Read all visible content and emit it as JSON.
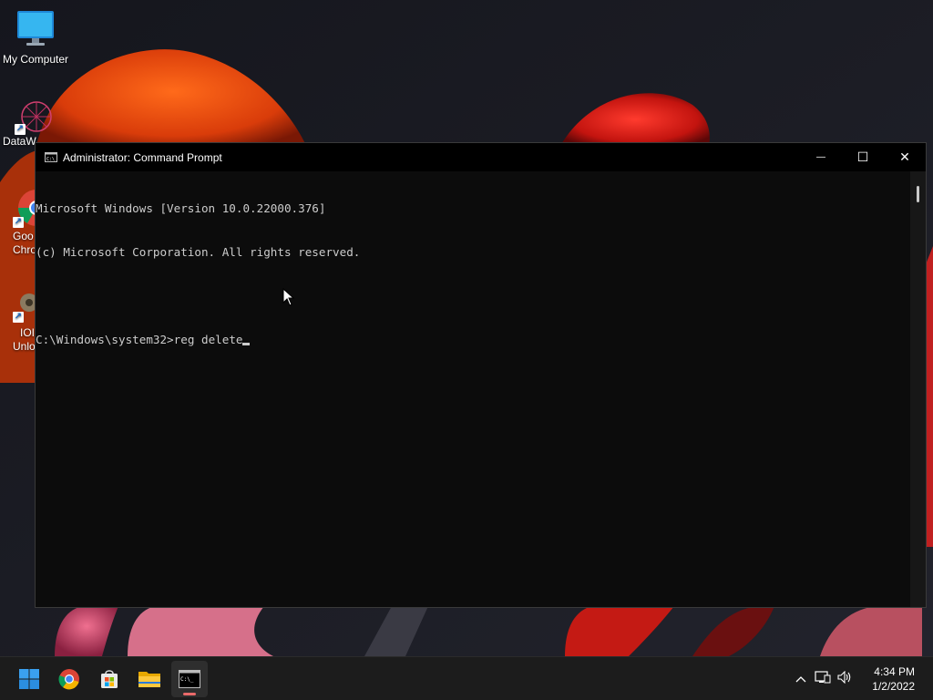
{
  "desktop": {
    "icons": [
      {
        "label": "My Computer"
      },
      {
        "label": "DataW"
      },
      {
        "label_line1": "Goo",
        "label_line2": "Chro"
      },
      {
        "label_line1": "IOI",
        "label_line2": "Unlo"
      }
    ]
  },
  "window": {
    "title": "Administrator: Command Prompt",
    "minimize_glyph": "—",
    "maximize_glyph": "☐",
    "close_glyph": "✕",
    "console_lines": [
      "Microsoft Windows [Version 10.0.22000.376]",
      "(c) Microsoft Corporation. All rights reserved."
    ],
    "prompt": "C:\\Windows\\system32>",
    "typed_command": "reg delete"
  },
  "taskbar": {
    "apps": [
      {
        "name": "start",
        "icon": "windows-logo-icon"
      },
      {
        "name": "chrome",
        "icon": "chrome-icon"
      },
      {
        "name": "store",
        "icon": "store-icon"
      },
      {
        "name": "file-explorer",
        "icon": "folder-icon"
      },
      {
        "name": "command-prompt",
        "icon": "cmd-icon",
        "active": true
      }
    ],
    "tray": {
      "chevron": "^",
      "time": "4:34 PM",
      "date": "1/2/2022"
    }
  },
  "colors": {
    "console_bg": "#0c0c0c",
    "console_text": "#cccccc",
    "taskbar_bg": "#1c1c1c",
    "active_indicator": "#ea6a6a"
  }
}
